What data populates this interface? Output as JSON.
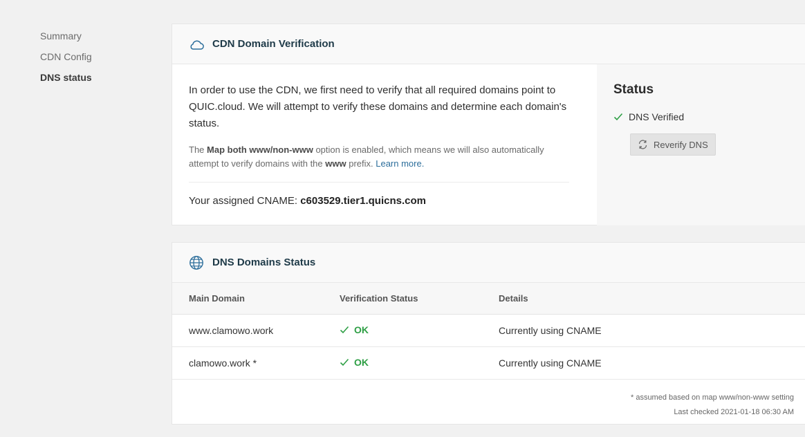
{
  "sidebar": {
    "items": [
      {
        "label": "Summary"
      },
      {
        "label": "CDN Config"
      },
      {
        "label": "DNS status"
      }
    ]
  },
  "verification": {
    "title": "CDN Domain Verification",
    "icon": "cloud-icon",
    "intro": "In order to use the CDN, we first need to verify that all required domains point to QUIC.cloud. We will attempt to verify these domains and determine each domain's status.",
    "note_prefix": "The ",
    "note_option": "Map both www/non-www",
    "note_middle": " option is enabled, which means we will also automatically attempt to verify domains with the ",
    "note_www": "www",
    "note_suffix": " prefix. ",
    "learn_more": "Learn more.",
    "cname_label": "Your assigned CNAME: ",
    "cname_value": "c603529.tier1.quicns.com"
  },
  "status": {
    "title": "Status",
    "state": "DNS Verified",
    "reverify_label": "Reverify DNS"
  },
  "domains": {
    "title": "DNS Domains Status",
    "icon": "globe-icon",
    "columns": [
      "Main Domain",
      "Verification Status",
      "Details"
    ],
    "rows": [
      {
        "domain": "www.clamowo.work",
        "status": "OK",
        "details": "Currently using CNAME"
      },
      {
        "domain": "clamowo.work *",
        "status": "OK",
        "details": "Currently using CNAME"
      }
    ],
    "footnote": "* assumed based on map www/non-www setting",
    "last_checked": "Last checked 2021-01-18 06:30 AM"
  },
  "colors": {
    "accent": "#2c6e9b",
    "ok": "#2e9f45"
  }
}
